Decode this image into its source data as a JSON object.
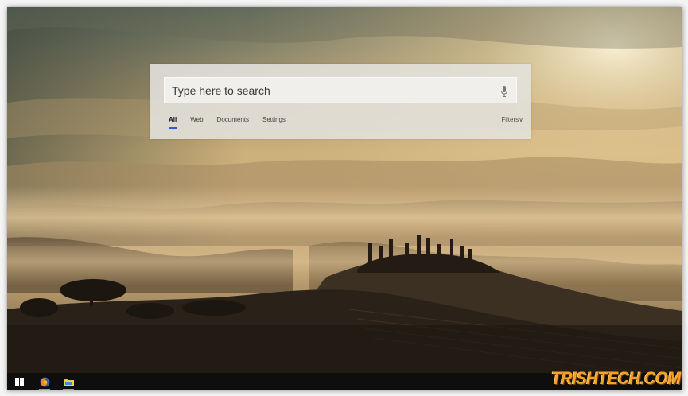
{
  "search": {
    "placeholder": "Type here to search",
    "tabs": [
      {
        "label": "All",
        "active": true
      },
      {
        "label": "Web",
        "active": false
      },
      {
        "label": "Documents",
        "active": false
      },
      {
        "label": "Settings",
        "active": false
      }
    ],
    "filters_label": "Filters∨"
  },
  "taskbar": {
    "items": [
      {
        "icon": "windows-start-icon"
      },
      {
        "icon": "firefox-icon"
      },
      {
        "icon": "file-explorer-icon"
      }
    ]
  },
  "watermark": {
    "text": "TRISHTECH.COM"
  },
  "colors": {
    "accent": "#2a5cd6",
    "taskbar": "#0e0e0e",
    "watermark": "#f2a12a"
  }
}
